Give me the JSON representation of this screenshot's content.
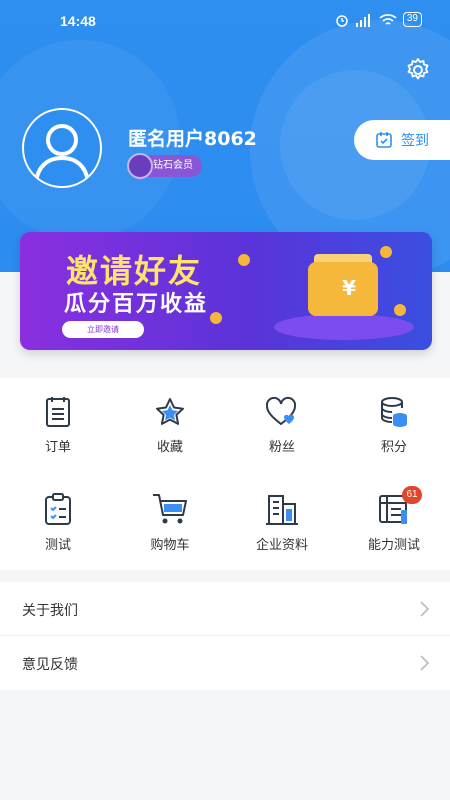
{
  "status_bar": {
    "time": "14:48",
    "battery": "39"
  },
  "profile": {
    "username": "匿名用户8062",
    "member_level": "钻石会员",
    "checkin_label": "签到"
  },
  "banner": {
    "title": "邀请好友",
    "subtitle": "瓜分百万收益",
    "button": "立即邀请"
  },
  "grid": {
    "items": [
      {
        "label": "订单",
        "icon": "order-icon"
      },
      {
        "label": "收藏",
        "icon": "star-icon"
      },
      {
        "label": "粉丝",
        "icon": "heart-icon"
      },
      {
        "label": "积分",
        "icon": "coins-icon"
      },
      {
        "label": "测试",
        "icon": "clipboard-icon"
      },
      {
        "label": "购物车",
        "icon": "cart-icon"
      },
      {
        "label": "企业资料",
        "icon": "building-icon"
      },
      {
        "label": "能力测试",
        "icon": "test-book-icon",
        "badge": "61"
      }
    ]
  },
  "list": {
    "items": [
      {
        "label": "关于我们"
      },
      {
        "label": "意见反馈"
      }
    ]
  },
  "colors": {
    "primary": "#2f8ff0",
    "badge": "#e2452b",
    "member": "#8a56d6"
  }
}
